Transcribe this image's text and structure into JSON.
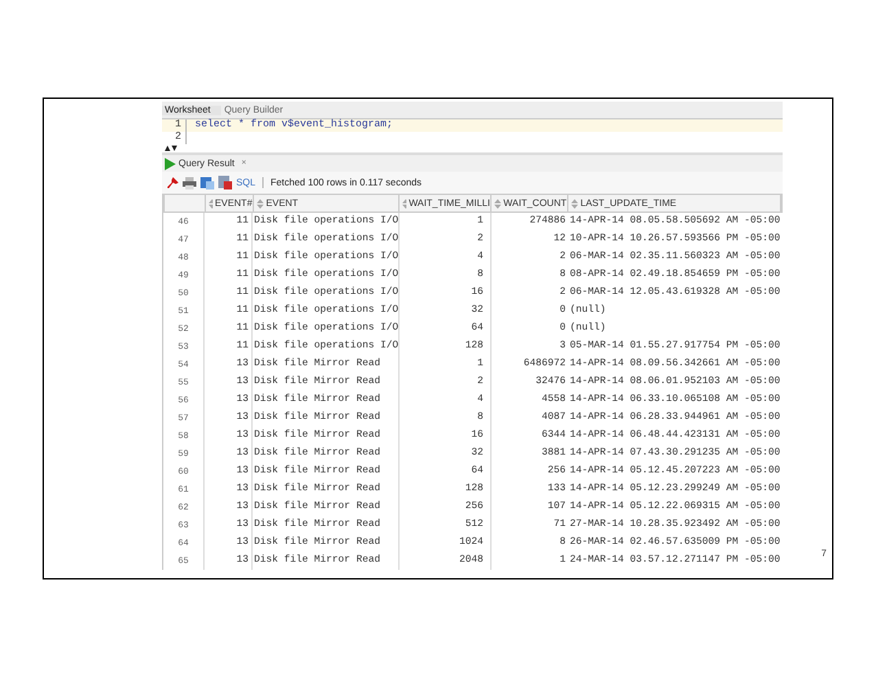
{
  "editor_tabs": [
    {
      "label": "Worksheet",
      "selected": true
    },
    {
      "label": "Query Builder",
      "selected": false
    }
  ],
  "editor": {
    "lines": [
      {
        "number": "1",
        "code": "select * from v$event_histogram;"
      },
      {
        "number": "2"
      }
    ]
  },
  "result_tab": {
    "label": "Query Result",
    "close": "×"
  },
  "toolbar": {
    "sql": "SQL",
    "status": "Fetched 100 rows in 0.117 seconds"
  },
  "table": {
    "columns": [
      "EVENT#",
      "EVENT",
      "WAIT_TIME_MILLI",
      "WAIT_COUNT",
      "LAST_UPDATE_TIME"
    ],
    "rows": [
      {
        "row": "46",
        "event_no": "11",
        "event": "Disk file operations I/O",
        "wait_time": "1",
        "wait_count": "274886",
        "last_update": "14-APR-14 08.05.58.505692 AM -05:00"
      },
      {
        "row": "47",
        "event_no": "11",
        "event": "Disk file operations I/O",
        "wait_time": "2",
        "wait_count": "12",
        "last_update": "10-APR-14 10.26.57.593566 PM -05:00"
      },
      {
        "row": "48",
        "event_no": "11",
        "event": "Disk file operations I/O",
        "wait_time": "4",
        "wait_count": "2",
        "last_update": "06-MAR-14 02.35.11.560323 AM -05:00"
      },
      {
        "row": "49",
        "event_no": "11",
        "event": "Disk file operations I/O",
        "wait_time": "8",
        "wait_count": "8",
        "last_update": "08-APR-14 02.49.18.854659 PM -05:00"
      },
      {
        "row": "50",
        "event_no": "11",
        "event": "Disk file operations I/O",
        "wait_time": "16",
        "wait_count": "2",
        "last_update": "06-MAR-14 12.05.43.619328 AM -05:00"
      },
      {
        "row": "51",
        "event_no": "11",
        "event": "Disk file operations I/O",
        "wait_time": "32",
        "wait_count": "0",
        "last_update": "(null)"
      },
      {
        "row": "52",
        "event_no": "11",
        "event": "Disk file operations I/O",
        "wait_time": "64",
        "wait_count": "0",
        "last_update": "(null)"
      },
      {
        "row": "53",
        "event_no": "11",
        "event": "Disk file operations I/O",
        "wait_time": "128",
        "wait_count": "3",
        "last_update": "05-MAR-14 01.55.27.917754 PM -05:00"
      },
      {
        "row": "54",
        "event_no": "13",
        "event": "Disk file Mirror Read",
        "wait_time": "1",
        "wait_count": "6486972",
        "last_update": "14-APR-14 08.09.56.342661 AM -05:00"
      },
      {
        "row": "55",
        "event_no": "13",
        "event": "Disk file Mirror Read",
        "wait_time": "2",
        "wait_count": "32476",
        "last_update": "14-APR-14 08.06.01.952103 AM -05:00"
      },
      {
        "row": "56",
        "event_no": "13",
        "event": "Disk file Mirror Read",
        "wait_time": "4",
        "wait_count": "4558",
        "last_update": "14-APR-14 06.33.10.065108 AM -05:00"
      },
      {
        "row": "57",
        "event_no": "13",
        "event": "Disk file Mirror Read",
        "wait_time": "8",
        "wait_count": "4087",
        "last_update": "14-APR-14 06.28.33.944961 AM -05:00"
      },
      {
        "row": "58",
        "event_no": "13",
        "event": "Disk file Mirror Read",
        "wait_time": "16",
        "wait_count": "6344",
        "last_update": "14-APR-14 06.48.44.423131 AM -05:00"
      },
      {
        "row": "59",
        "event_no": "13",
        "event": "Disk file Mirror Read",
        "wait_time": "32",
        "wait_count": "3881",
        "last_update": "14-APR-14 07.43.30.291235 AM -05:00"
      },
      {
        "row": "60",
        "event_no": "13",
        "event": "Disk file Mirror Read",
        "wait_time": "64",
        "wait_count": "256",
        "last_update": "14-APR-14 05.12.45.207223 AM -05:00"
      },
      {
        "row": "61",
        "event_no": "13",
        "event": "Disk file Mirror Read",
        "wait_time": "128",
        "wait_count": "133",
        "last_update": "14-APR-14 05.12.23.299249 AM -05:00"
      },
      {
        "row": "62",
        "event_no": "13",
        "event": "Disk file Mirror Read",
        "wait_time": "256",
        "wait_count": "107",
        "last_update": "14-APR-14 05.12.22.069315 AM -05:00"
      },
      {
        "row": "63",
        "event_no": "13",
        "event": "Disk file Mirror Read",
        "wait_time": "512",
        "wait_count": "71",
        "last_update": "27-MAR-14 10.28.35.923492 AM -05:00"
      },
      {
        "row": "64",
        "event_no": "13",
        "event": "Disk file Mirror Read",
        "wait_time": "1024",
        "wait_count": "8",
        "last_update": "26-MAR-14 02.46.57.635009 PM -05:00"
      },
      {
        "row": "65",
        "event_no": "13",
        "event": "Disk file Mirror Read",
        "wait_time": "2048",
        "wait_count": "1",
        "last_update": "24-MAR-14 03.57.12.271147 PM -05:00"
      }
    ]
  },
  "slide_number": "7"
}
